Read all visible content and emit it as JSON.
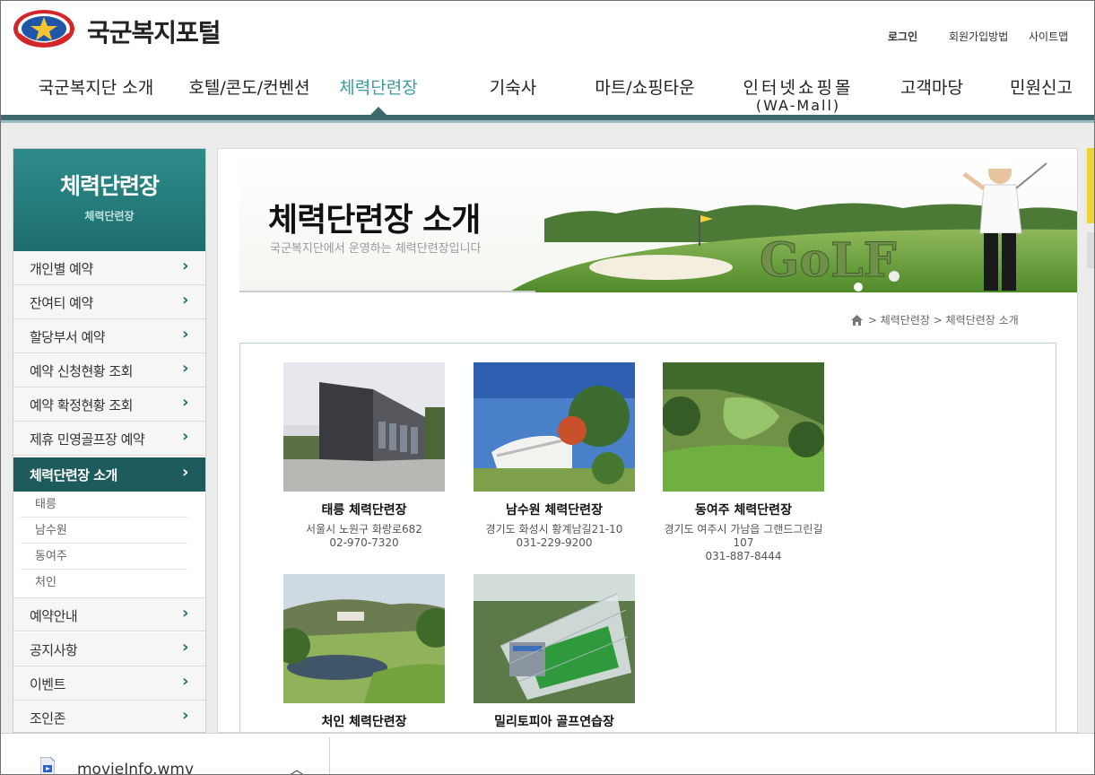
{
  "header": {
    "site_title": "국군복지포털",
    "util_links": {
      "login": "로그인",
      "join": "회원가입방법",
      "sitemap": "사이트맵"
    }
  },
  "gnb": {
    "items": [
      {
        "label": "국군복지단 소개"
      },
      {
        "label": "호텔/콘도/컨벤션"
      },
      {
        "label": "체력단련장",
        "active": true
      },
      {
        "label": "기숙사"
      },
      {
        "label": "마트/쇼핑타운"
      },
      {
        "label": "인터넷쇼핑몰",
        "sub": "(WA-Mall)"
      },
      {
        "label": "고객마당"
      },
      {
        "label": "민원신고"
      }
    ]
  },
  "lnb": {
    "title": "체력단련장",
    "subtitle": "체력단련장",
    "items": [
      {
        "label": "개인별 예약"
      },
      {
        "label": "잔여티 예약"
      },
      {
        "label": "할당부서 예약"
      },
      {
        "label": "예약 신청현황 조회"
      },
      {
        "label": "예약 확정현황 조회"
      },
      {
        "label": "제휴 민영골프장 예약"
      },
      {
        "label": "체력단련장 소개",
        "active": true
      },
      {
        "label": "예약안내"
      },
      {
        "label": "공지사항"
      },
      {
        "label": "이벤트"
      },
      {
        "label": "조인존"
      }
    ],
    "sub_items": [
      "태릉",
      "남수원",
      "동여주",
      "처인"
    ]
  },
  "page": {
    "title": "체력단련장 소개",
    "description": "국군복지단에서 운영하는 체력단련장입니다",
    "banner_word": "GoLF"
  },
  "breadcrumb": {
    "level1": "체력단련장",
    "level2": "체력단련장 소개"
  },
  "facilities": [
    {
      "name": "태릉 체력단련장",
      "address": "서울시 노원구 화랑로682",
      "phone": "02-970-7320"
    },
    {
      "name": "남수원 체력단련장",
      "address": "경기도 화성시 황계남길21-10",
      "phone": "031-229-9200"
    },
    {
      "name": "동여주 체력단련장",
      "address": "경기도 여주시 가남읍 그랜드그린길107",
      "phone": "031-887-8444"
    },
    {
      "name": "처인 체력단련장",
      "address": "",
      "phone": ""
    },
    {
      "name": "밀리토피아 골프연습장",
      "address": "",
      "phone": ""
    }
  ],
  "download": {
    "filename": "movieInfo.wmv"
  },
  "colors": {
    "accent": "#3a9c99",
    "menu_dark": "#1d5b5c",
    "gnb_line": "#3e6a6e"
  }
}
